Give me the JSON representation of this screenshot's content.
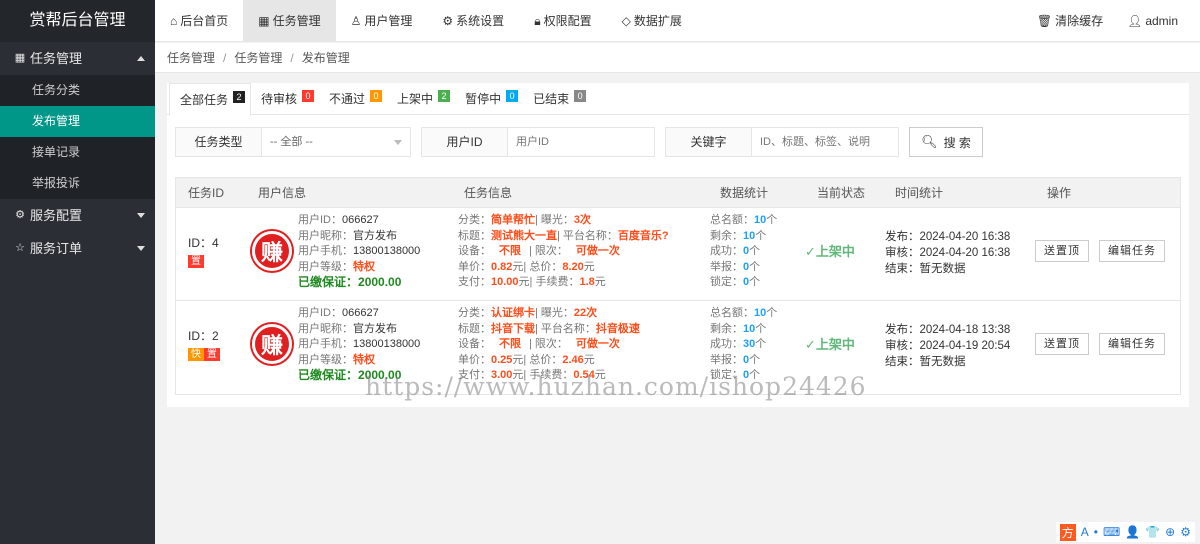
{
  "brand": "赏帮后台管理",
  "sidebar": {
    "groups": [
      {
        "icon": "grid-icon",
        "label": "任务管理",
        "expanded": true,
        "items": [
          "任务分类",
          "发布管理",
          "接单记录",
          "举报投诉"
        ],
        "active": "发布管理"
      },
      {
        "icon": "gear-icon",
        "label": "服务配置",
        "expanded": false
      },
      {
        "icon": "star-icon",
        "label": "服务订单",
        "expanded": false
      }
    ]
  },
  "topnav": {
    "items": [
      "后台首页",
      "任务管理",
      "用户管理",
      "系统设置",
      "权限配置",
      "数据扩展"
    ],
    "active": "任务管理",
    "clear_cache": "清除缓存",
    "user": "admin"
  },
  "breadcrumb": [
    "任务管理",
    "任务管理",
    "发布管理"
  ],
  "tabs": [
    {
      "label": "全部任务",
      "count": "2",
      "color": "#222222"
    },
    {
      "label": "待审核",
      "count": "0",
      "color": "#ff3b30"
    },
    {
      "label": "不通过",
      "count": "0",
      "color": "#ff9800"
    },
    {
      "label": "上架中",
      "count": "2",
      "color": "#4caf50"
    },
    {
      "label": "暂停中",
      "count": "0",
      "color": "#03a9f4"
    },
    {
      "label": "已结束",
      "count": "0",
      "color": "#888888"
    }
  ],
  "filters": {
    "type_label": "任务类型",
    "type_value": "-- 全部 --",
    "uid_label": "用户ID",
    "uid_placeholder": "用户ID",
    "keyword_label": "关键字",
    "keyword_placeholder": "ID、标题、标签、说明",
    "search_button": "搜 索"
  },
  "table": {
    "headers": [
      "任务ID",
      "用户信息",
      "任务信息",
      "数据统计",
      "当前状态",
      "时间统计",
      "操作"
    ],
    "user_labels": {
      "uid": "用户ID：",
      "nick": "用户昵称：",
      "phone": "用户手机：",
      "level": "用户等级：",
      "deposit": "已缴保证：",
      "logo": "赚"
    },
    "task_labels": {
      "cat": "分类：",
      "exposure": "| 曝光：",
      "title": "标题：",
      "platform": "| 平台名称：",
      "device": "设备：",
      "limit": "| 限次：",
      "unit": "单价：",
      "total": "| 总价：",
      "pay": "支付：",
      "fee": "| 手续费：",
      "yuan": "元"
    },
    "stat_labels": {
      "quota": "总名额：",
      "remain": "剩余：",
      "success": "成功：",
      "report": "举报：",
      "locked": "锁定：",
      "unit": "个"
    },
    "time_labels": {
      "publish": "发布：",
      "review": "审核：",
      "end": "结束："
    },
    "ops": {
      "top": "送置顶",
      "edit": "编辑任务"
    },
    "rows": [
      {
        "id_label": "ID：",
        "id": "4",
        "tags": [
          {
            "text": "置",
            "color": "#ff3b30"
          }
        ],
        "uid": "066627",
        "nick": "官方发布",
        "phone": "13800138000",
        "level": "特权",
        "deposit": "2000.00",
        "category": "简单帮忙",
        "exposure": "3次",
        "title": "测试熊大一直",
        "platform": "百度音乐?",
        "device": "不限",
        "limit": "可做一次",
        "unit_price": "0.82",
        "total_price": "8.20",
        "pay": "10.00",
        "fee": "1.8",
        "quota": "10",
        "remain": "10",
        "success": "0",
        "report": "0",
        "locked": "0",
        "status": "上架中",
        "publish": "2024-04-20 16:38",
        "review": "2024-04-20 16:38",
        "end": "暂无数据"
      },
      {
        "id_label": "ID：",
        "id": "2",
        "tags": [
          {
            "text": "快",
            "color": "#ff9800"
          },
          {
            "text": "置",
            "color": "#ff3b30"
          }
        ],
        "uid": "066627",
        "nick": "官方发布",
        "phone": "13800138000",
        "level": "特权",
        "deposit": "2000.00",
        "category": "认证绑卡",
        "exposure": "22次",
        "title": "抖音下载",
        "platform": "抖音极速",
        "device": "不限",
        "limit": "可做一次",
        "unit_price": "0.25",
        "total_price": "2.46",
        "pay": "3.00",
        "fee": "0.54",
        "quota": "10",
        "remain": "10",
        "success": "30",
        "report": "0",
        "locked": "0",
        "status": "上架中",
        "publish": "2024-04-18 13:38",
        "review": "2024-04-19 20:54",
        "end": "暂无数据"
      }
    ]
  },
  "watermark": "https://www.huzhan.com/ishop24426",
  "systray": [
    "方",
    "A",
    "•",
    "⌨",
    "👤",
    "👕",
    "⊕",
    "⚙"
  ]
}
